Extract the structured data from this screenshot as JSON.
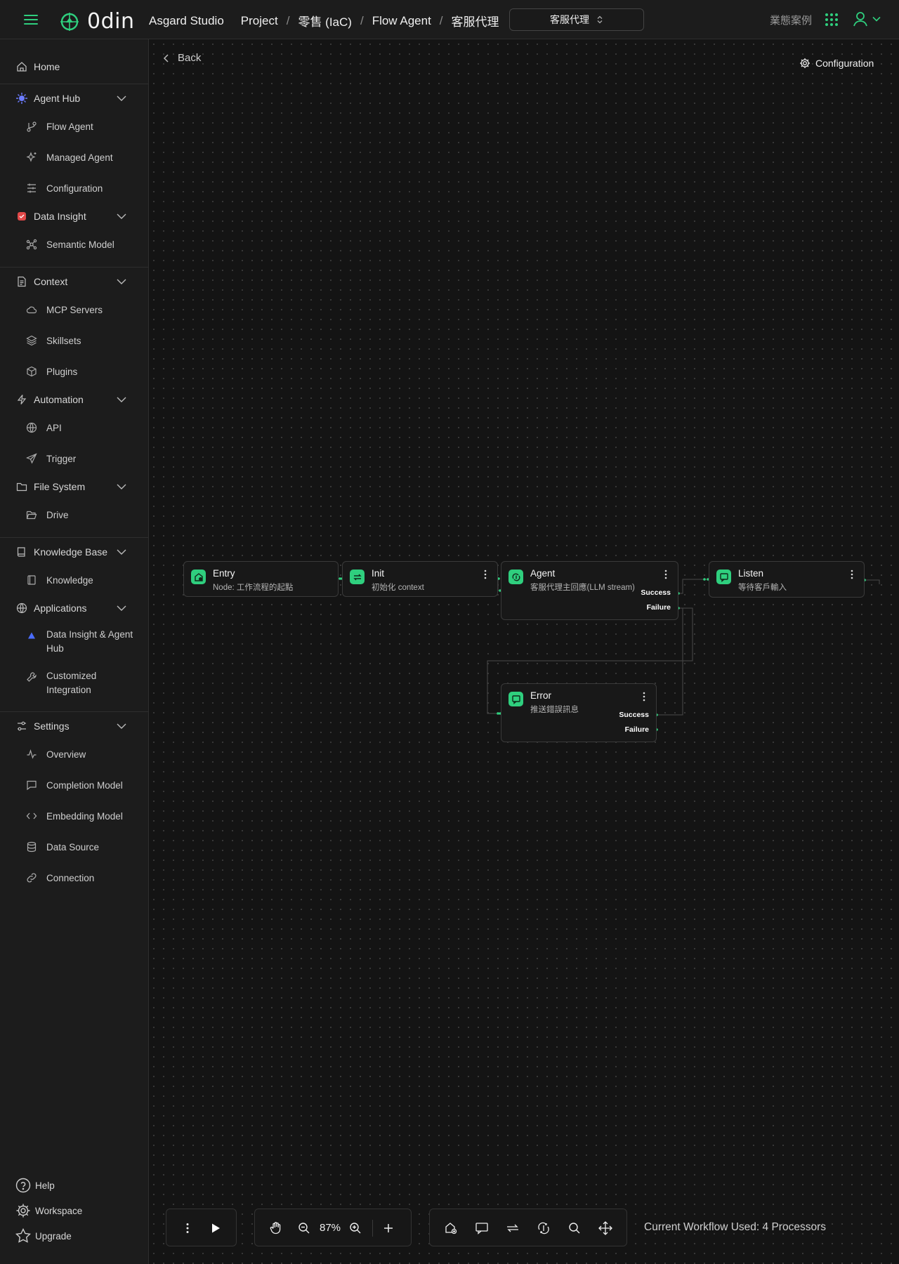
{
  "header": {
    "app_name": "0din",
    "breadcrumb": {
      "studio": "Asgard Studio",
      "items": [
        "Project",
        "零售 (IaC)",
        "Flow Agent",
        "客服代理"
      ],
      "separator": "/"
    },
    "selector": {
      "value": "客服代理"
    },
    "case_link": "業態案例",
    "accent_color": "#2fcf7e"
  },
  "sidebar": {
    "home": "Home",
    "agent_hub": {
      "label": "Agent Hub",
      "items": [
        "Flow Agent",
        "Managed Agent",
        "Configuration"
      ]
    },
    "data_insight": {
      "label": "Data Insight",
      "items": [
        "Semantic Model"
      ]
    },
    "context": {
      "label": "Context",
      "items": [
        "MCP Servers",
        "Skillsets",
        "Plugins"
      ]
    },
    "automation": {
      "label": "Automation",
      "items": [
        "API",
        "Trigger"
      ]
    },
    "file_system": {
      "label": "File System",
      "items": [
        "Drive"
      ]
    },
    "knowledge_base": {
      "label": "Knowledge Base",
      "items": [
        "Knowledge"
      ]
    },
    "applications": {
      "label": "Applications",
      "items": [
        "Data Insight & Agent Hub",
        "Customized Integration"
      ]
    },
    "settings": {
      "label": "Settings",
      "items": [
        "Overview",
        "Completion Model",
        "Embedding Model",
        "Data Source",
        "Connection"
      ]
    },
    "footer": {
      "help": "Help",
      "workspace": "Workspace",
      "upgrade": "Upgrade"
    }
  },
  "canvas": {
    "back_label": "Back",
    "configuration_label": "Configuration",
    "nodes": [
      {
        "title": "Entry",
        "desc": "Node: 工作流程的起點",
        "icon": "entry-icon"
      },
      {
        "title": "Init",
        "desc": "初始化 context",
        "icon": "transform-icon"
      },
      {
        "title": "Agent",
        "desc": "客服代理主回應(LLM stream)",
        "icon": "agent-icon",
        "outputs": [
          "Success",
          "Failure"
        ]
      },
      {
        "title": "Listen",
        "desc": "等待客戶輸入",
        "icon": "message-icon"
      },
      {
        "title": "Error",
        "desc": "推送錯誤訊息",
        "icon": "message-icon",
        "outputs": [
          "Success",
          "Failure"
        ]
      }
    ]
  },
  "toolbar": {
    "zoom": "87%",
    "status": "Current Workflow Used: 4 Processors"
  }
}
